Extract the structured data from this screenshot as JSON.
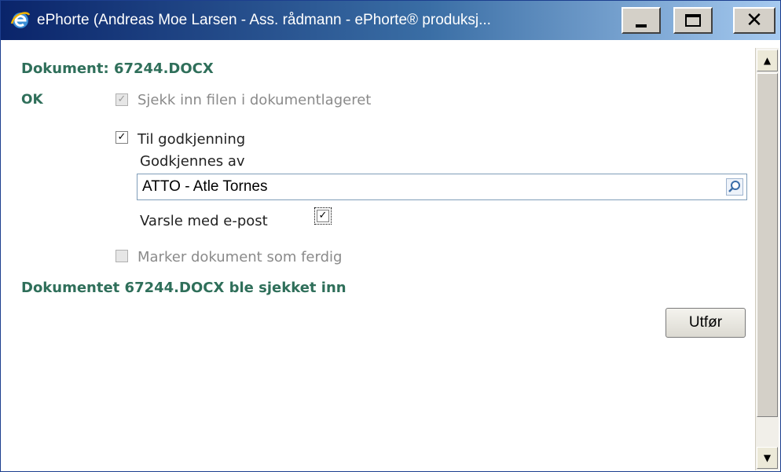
{
  "window": {
    "title": "ePhorte (Andreas Moe Larsen - Ass. rådmann - ePhorte® produksj..."
  },
  "icons": {
    "app": "ie-icon",
    "lookup": "magnifier-icon"
  },
  "document": {
    "title": "Dokument: 67244.DOCX",
    "ok_label": "OK"
  },
  "options": {
    "checkin_label": "Sjekk inn filen i dokumentlageret",
    "checkin_checked": true,
    "approval_label": "Til godkjenning",
    "approval_checked": true,
    "approver_label": "Godkjennes av",
    "approver_value": "ATTO - Atle Tornes",
    "notify_label": "Varsle med e-post",
    "notify_checked": true,
    "finish_label": "Marker dokument som ferdig",
    "finish_checked": false
  },
  "status": {
    "message": "Dokumentet 67244.DOCX ble sjekket inn"
  },
  "actions": {
    "execute_label": "Utfør"
  },
  "colors": {
    "accent_text": "#2f6f5a",
    "titlebar_start": "#0a246a",
    "titlebar_end": "#a6caf0"
  }
}
